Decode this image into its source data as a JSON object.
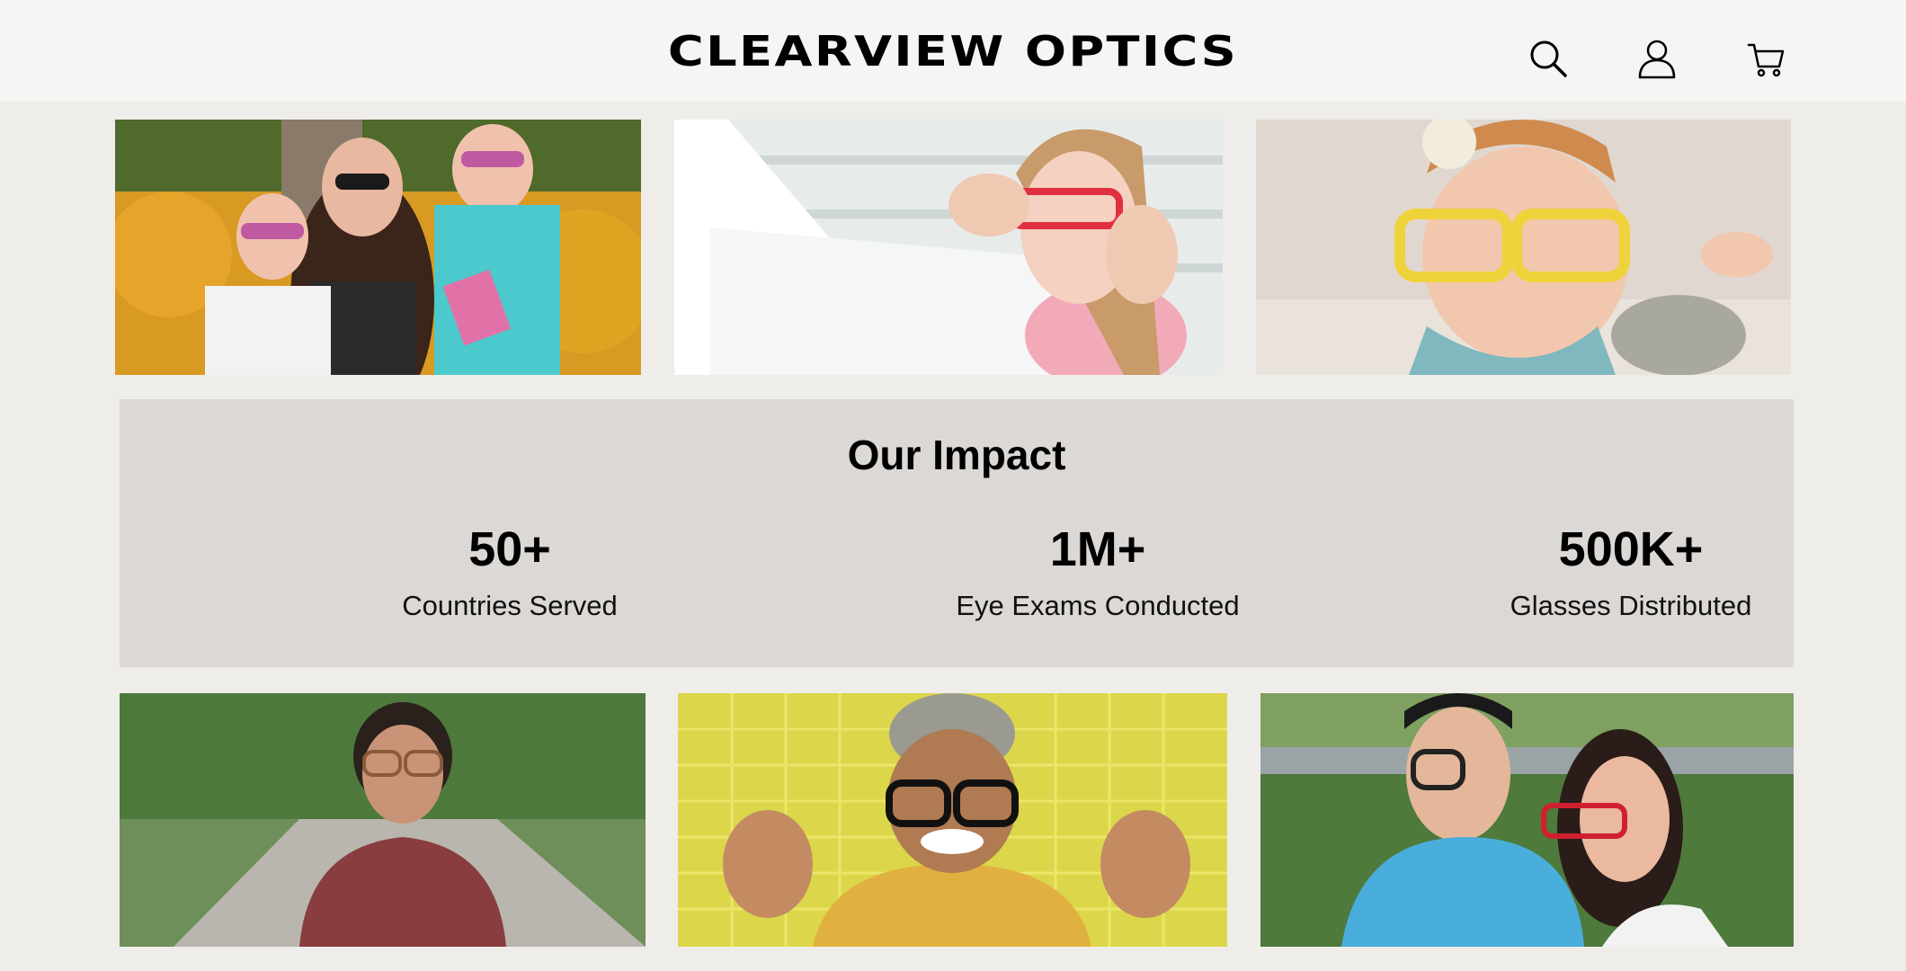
{
  "header": {
    "brand": "CLEARVIEW OPTICS",
    "icons": [
      "search-icon",
      "user-icon",
      "cart-icon"
    ]
  },
  "photos_top": [
    {
      "name": "family-sunglasses-photo"
    },
    {
      "name": "girl-fitting-photo"
    },
    {
      "name": "baby-yellow-glasses-photo"
    }
  ],
  "impact": {
    "title": "Our Impact",
    "stats": [
      {
        "value": "50+",
        "label": "Countries Served"
      },
      {
        "value": "1M+",
        "label": "Eye Exams Conducted"
      },
      {
        "value": "500K+",
        "label": "Glasses Distributed"
      }
    ]
  },
  "photos_bottom": [
    {
      "name": "senior-woman-photo"
    },
    {
      "name": "kid-thumbs-up-photo"
    },
    {
      "name": "couple-glasses-photo"
    }
  ],
  "colors": {
    "page_bg": "#efedea",
    "header_bg": "#f6f5f3",
    "impact_bg": "#dbd8d5",
    "text": "#000000"
  }
}
